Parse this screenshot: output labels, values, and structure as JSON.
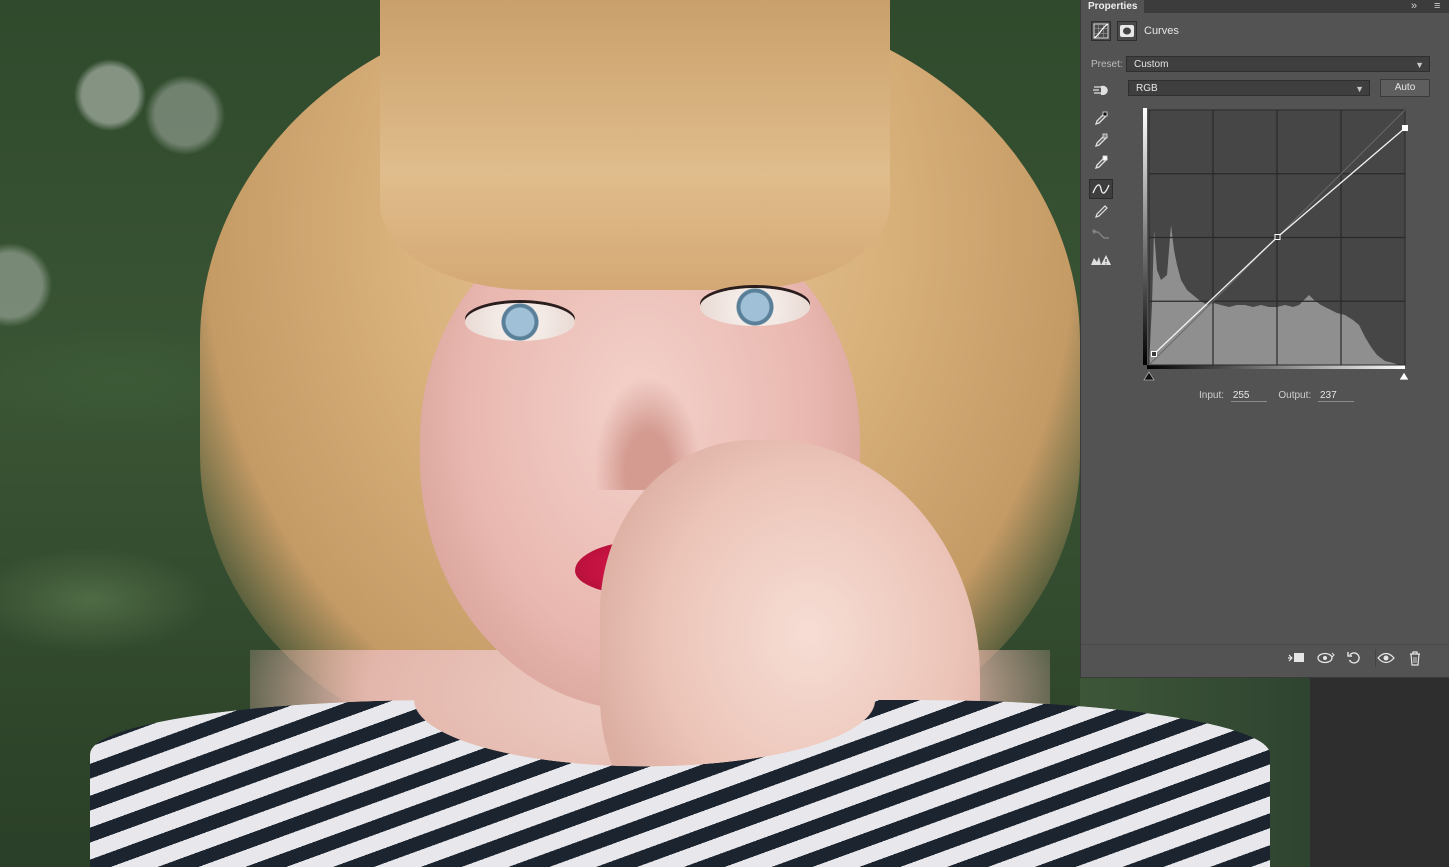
{
  "panel": {
    "tab_label": "Properties",
    "collapse_glyph": "»",
    "menu_glyph": "≡",
    "adjustment_title": "Curves",
    "adjustment_icon": "curves-adjustment-icon",
    "mask_icon": "layer-mask-icon",
    "preset_label": "Preset:",
    "preset_value": "Custom",
    "channel_value": "RGB",
    "auto_label": "Auto",
    "tools": [
      {
        "name": "on-image-adjust-icon"
      },
      {
        "name": "black-point-eyedropper-icon"
      },
      {
        "name": "gray-point-eyedropper-icon"
      },
      {
        "name": "white-point-eyedropper-icon"
      },
      {
        "name": "curve-points-icon",
        "active": true
      },
      {
        "name": "pencil-icon"
      },
      {
        "name": "smooth-curve-icon"
      },
      {
        "name": "clipping-warning-icon"
      }
    ],
    "input_label": "Input:",
    "input_value": "255",
    "output_label": "Output:",
    "output_value": "237",
    "footer_buttons": [
      "clip-to-layer-icon",
      "view-previous-state-icon",
      "reset-icon",
      "visibility-eye-icon",
      "delete-trash-icon"
    ]
  },
  "curve": {
    "points": [
      [
        5,
        11
      ],
      [
        128,
        128
      ],
      [
        255,
        237
      ]
    ],
    "range": [
      0,
      255
    ],
    "grid_divisions": 4,
    "histogram_color": "#8f8f8f",
    "grid_color": "#2a2a2a",
    "background_color": "#464646"
  },
  "colors": {
    "panel_bg": "#535353",
    "lips": "#c2123f",
    "hair": "#d8b07a",
    "background_foliage": "#3a5534"
  }
}
